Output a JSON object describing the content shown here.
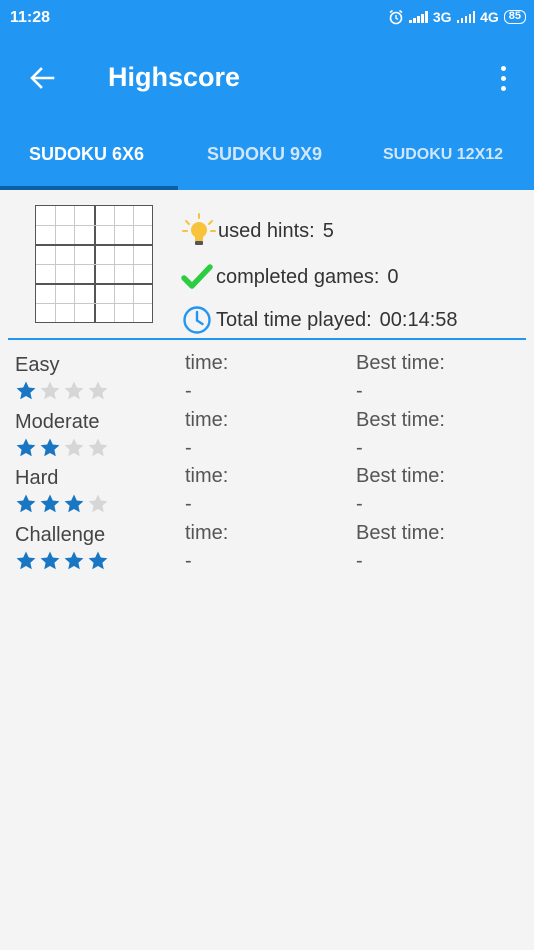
{
  "status_bar": {
    "time": "11:28",
    "net1": "3G",
    "net2": "4G",
    "battery": "85"
  },
  "toolbar": {
    "title": "Highscore"
  },
  "tabs": [
    {
      "label": "SUDOKU 6X6",
      "active": true
    },
    {
      "label": "SUDOKU 9X9",
      "active": false
    },
    {
      "label": "SUDOKU 12X12",
      "active": false
    }
  ],
  "stats": {
    "hints_label": "used hints:",
    "hints_value": "5",
    "completed_label": "completed games:",
    "completed_value": "0",
    "time_label": "Total time played:",
    "time_value": "00:14:58"
  },
  "difficulties": [
    {
      "name": "Easy",
      "stars": 1,
      "time_label": "time:",
      "time_value": "-",
      "best_label": "Best time:",
      "best_value": "-"
    },
    {
      "name": "Moderate",
      "stars": 2,
      "time_label": "time:",
      "time_value": "-",
      "best_label": "Best time:",
      "best_value": "-"
    },
    {
      "name": "Hard",
      "stars": 3,
      "time_label": "time:",
      "time_value": "-",
      "best_label": "Best time:",
      "best_value": "-"
    },
    {
      "name": "Challenge",
      "stars": 4,
      "time_label": "time:",
      "time_value": "-",
      "best_label": "Best time:",
      "best_value": "-"
    }
  ],
  "colors": {
    "primary": "#2196f3",
    "accent": "#0b5fa5",
    "star_on": "#1976c2",
    "star_off": "#d6d6d6",
    "check": "#2ecc40",
    "bulb": "#f7c33b"
  },
  "icons": {
    "back": "arrow-left-icon",
    "menu": "more-vert-icon",
    "hint": "lightbulb-icon",
    "completed": "checkmark-icon",
    "time": "clock-icon",
    "grid": "sudoku-grid-icon"
  }
}
